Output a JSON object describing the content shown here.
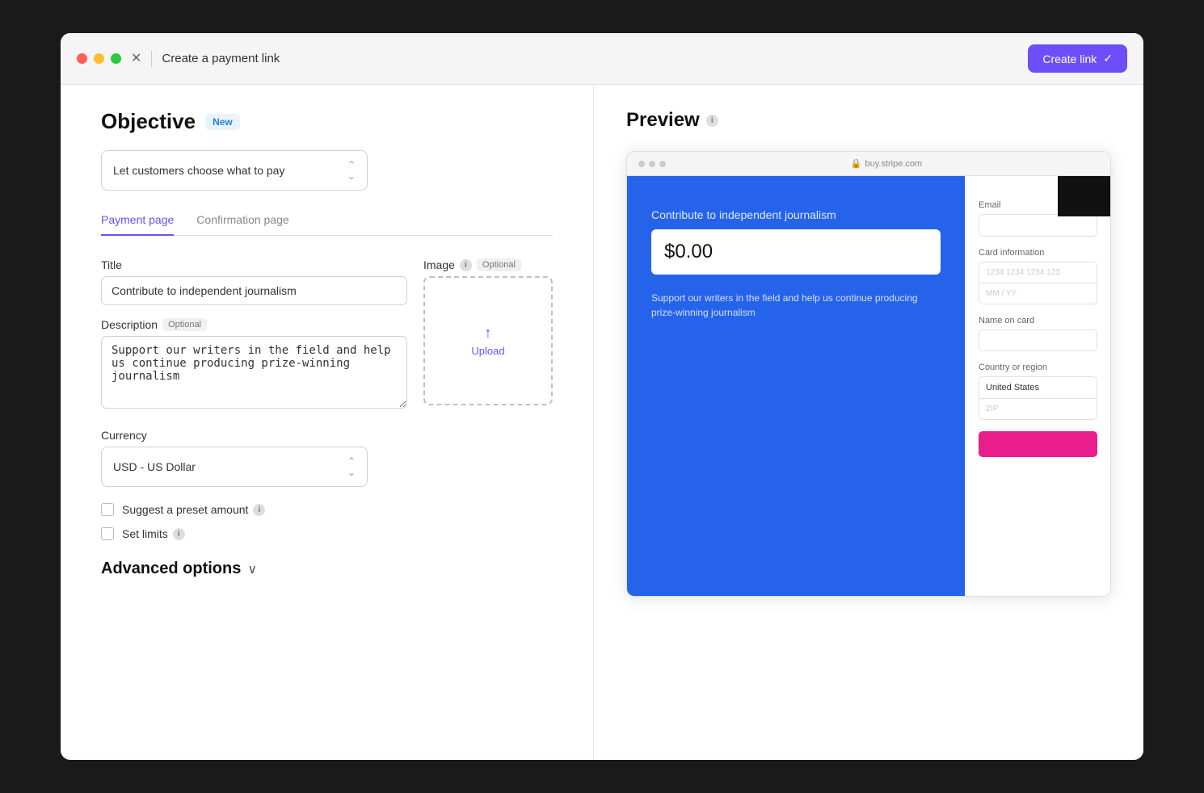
{
  "window": {
    "title": "Create a payment link"
  },
  "header": {
    "close_label": "×",
    "title": "Create a payment link",
    "create_btn_label": "Create link",
    "create_btn_check": "✓"
  },
  "objective": {
    "title": "Objective",
    "badge": "New",
    "dropdown_label": "Let customers choose what to pay"
  },
  "tabs": [
    {
      "label": "Payment page",
      "active": true
    },
    {
      "label": "Confirmation page",
      "active": false
    }
  ],
  "form": {
    "title_label": "Title",
    "title_value": "Contribute to independent journalism",
    "image_label": "Image",
    "image_optional": "Optional",
    "upload_label": "Upload",
    "description_label": "Description",
    "description_optional": "Optional",
    "description_value": "Support our writers in the field and help us continue producing prize-winning journalism",
    "currency_label": "Currency",
    "currency_value": "USD - US Dollar",
    "suggest_preset_label": "Suggest a preset amount",
    "set_limits_label": "Set limits"
  },
  "advanced": {
    "label": "Advanced options"
  },
  "preview": {
    "title": "Preview",
    "url": "buy.stripe.com",
    "payment_title": "Contribute to independent journalism",
    "amount_placeholder": "$0.00",
    "description": "Support our writers in the field and help us continue producing prize-winning journalism",
    "email_label": "Email",
    "card_info_label": "Card information",
    "card_number_placeholder": "1234 1234 1234 123",
    "card_date_placeholder": "MM / YY",
    "name_on_card_label": "Name on card",
    "country_label": "Country or region",
    "country_value": "United States",
    "zip_placeholder": "ZIP"
  }
}
